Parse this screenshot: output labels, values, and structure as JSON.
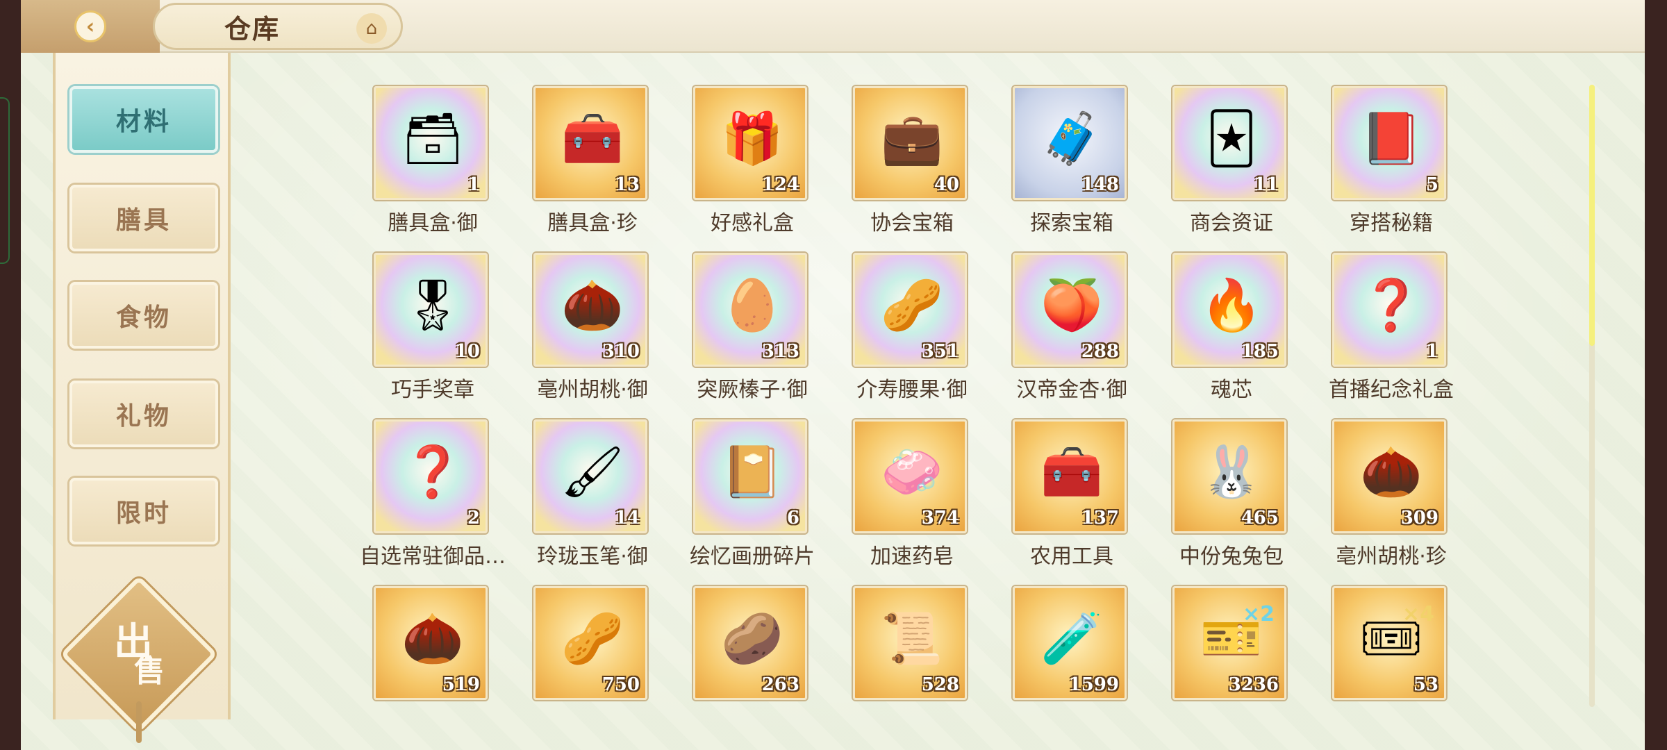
{
  "header": {
    "back_icon": "chevron-left-icon",
    "title": "仓库",
    "home_icon": "pavilion-icon"
  },
  "menu": {
    "items": [
      {
        "label": "材料",
        "active": true
      },
      {
        "label": "膳具",
        "active": false
      },
      {
        "label": "食物",
        "active": false
      },
      {
        "label": "礼物",
        "active": false
      },
      {
        "label": "限时",
        "active": false
      }
    ],
    "sell": {
      "char1": "出",
      "char2": "售"
    }
  },
  "items": [
    {
      "name": "膳具盒·御",
      "qty": "1",
      "bg": "rainbow",
      "icon": "dark-lacquer-box-icon",
      "glyph": "🗃"
    },
    {
      "name": "膳具盒·珍",
      "qty": "13",
      "bg": "gold",
      "icon": "red-lacquer-box-icon",
      "glyph": "🧰"
    },
    {
      "name": "好感礼盒",
      "qty": "124",
      "bg": "gold",
      "icon": "gift-box-icon",
      "glyph": "🎁"
    },
    {
      "name": "协会宝箱",
      "qty": "40",
      "bg": "gold",
      "icon": "red-chest-icon",
      "glyph": "💼"
    },
    {
      "name": "探索宝箱",
      "qty": "148",
      "bg": "grey",
      "icon": "open-treasure-chest-icon",
      "glyph": "🧳"
    },
    {
      "name": "商会资证",
      "qty": "11",
      "bg": "rainbow",
      "icon": "card-certificate-icon",
      "glyph": "🃏"
    },
    {
      "name": "穿搭秘籍",
      "qty": "5",
      "bg": "rainbow",
      "icon": "red-book-icon",
      "glyph": "📕"
    },
    {
      "name": "巧手奖章",
      "qty": "10",
      "bg": "rainbow",
      "icon": "medal-icon",
      "glyph": "🎖"
    },
    {
      "name": "亳州胡桃·御",
      "qty": "310",
      "bg": "rainbow",
      "icon": "walnut-icon",
      "glyph": "🌰"
    },
    {
      "name": "突厥榛子·御",
      "qty": "313",
      "bg": "rainbow",
      "icon": "hazelnut-icon",
      "glyph": "🥚"
    },
    {
      "name": "介寿腰果·御",
      "qty": "351",
      "bg": "rainbow",
      "icon": "cashew-icon",
      "glyph": "🥜"
    },
    {
      "name": "汉帝金杏·御",
      "qty": "288",
      "bg": "rainbow",
      "icon": "almond-icon",
      "glyph": "🍑"
    },
    {
      "name": "魂芯",
      "qty": "185",
      "bg": "rainbow",
      "icon": "spirit-flame-icon",
      "glyph": "🔥"
    },
    {
      "name": "首播纪念礼盒",
      "qty": "1",
      "bg": "rainbow",
      "icon": "mystery-silhouette-icon",
      "glyph": "❓"
    },
    {
      "name": "自选常驻御品…",
      "qty": "2",
      "bg": "rainbow",
      "icon": "mystery-silhouette-icon",
      "glyph": "❓"
    },
    {
      "name": "玲珑玉笔·御",
      "qty": "14",
      "bg": "rainbow",
      "icon": "jade-brush-icon",
      "glyph": "🖌"
    },
    {
      "name": "绘忆画册碎片",
      "qty": "6",
      "bg": "rainbow",
      "icon": "album-fragment-icon",
      "glyph": "📔"
    },
    {
      "name": "加速药皂",
      "qty": "374",
      "bg": "gold",
      "icon": "green-soap-icon",
      "glyph": "🧼"
    },
    {
      "name": "农用工具",
      "qty": "137",
      "bg": "gold",
      "icon": "toolbox-icon",
      "glyph": "🧰"
    },
    {
      "name": "中份兔兔包",
      "qty": "465",
      "bg": "gold",
      "icon": "rabbit-bun-icon",
      "glyph": "🐰"
    },
    {
      "name": "亳州胡桃·珍",
      "qty": "309",
      "bg": "gold",
      "icon": "walnut-icon",
      "glyph": "🌰"
    },
    {
      "name": "",
      "qty": "519",
      "bg": "gold",
      "icon": "hazelnut-icon",
      "glyph": "🌰"
    },
    {
      "name": "",
      "qty": "750",
      "bg": "gold",
      "icon": "cashew-icon",
      "glyph": "🥜"
    },
    {
      "name": "",
      "qty": "263",
      "bg": "gold",
      "icon": "almond-icon",
      "glyph": "🥔"
    },
    {
      "name": "",
      "qty": "528",
      "bg": "gold",
      "icon": "recipe-scroll-icon",
      "glyph": "📜"
    },
    {
      "name": "",
      "qty": "1599",
      "bg": "gold",
      "icon": "potion-bottle-icon",
      "glyph": "🧪"
    },
    {
      "name": "",
      "qty": "3236",
      "bg": "gold",
      "icon": "blue-ticket-icon",
      "glyph": "🎫"
    },
    {
      "name": "",
      "qty": "53",
      "bg": "gold",
      "icon": "gold-ticket-icon",
      "glyph": "🎟"
    }
  ],
  "ticket_multipliers": {
    "blue": "×2",
    "gold": "×4"
  },
  "scroll": {
    "position_fraction": 0.0,
    "visible_fraction": 0.42
  }
}
